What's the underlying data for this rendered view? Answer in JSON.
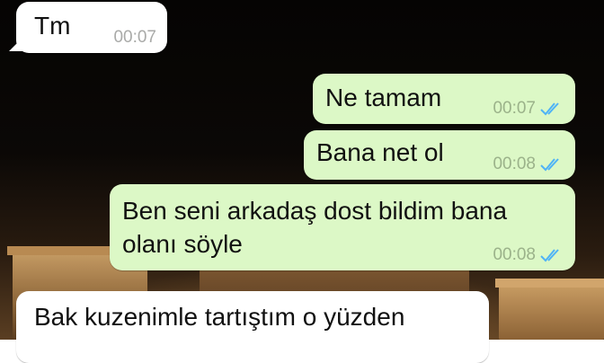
{
  "chat": {
    "messages": [
      {
        "direction": "incoming",
        "text": "Tm",
        "time": "00:07"
      },
      {
        "direction": "outgoing",
        "text": "Ne tamam",
        "time": "00:07",
        "status": "read"
      },
      {
        "direction": "outgoing",
        "text": "Bana net ol",
        "time": "00:08",
        "status": "read"
      },
      {
        "direction": "outgoing",
        "text": "Ben seni arkadaş dost bildim bana\nolanı söyle",
        "time": "00:08",
        "status": "read"
      },
      {
        "direction": "incoming",
        "text": "Bak kuzenimle tartıştım o yüzden",
        "time": ""
      }
    ]
  },
  "colors": {
    "incoming_bubble": "#ffffff",
    "outgoing_bubble": "#dcf8c6",
    "read_tick": "#4fb3f6"
  },
  "icons": {
    "status": "double-check-icon"
  }
}
